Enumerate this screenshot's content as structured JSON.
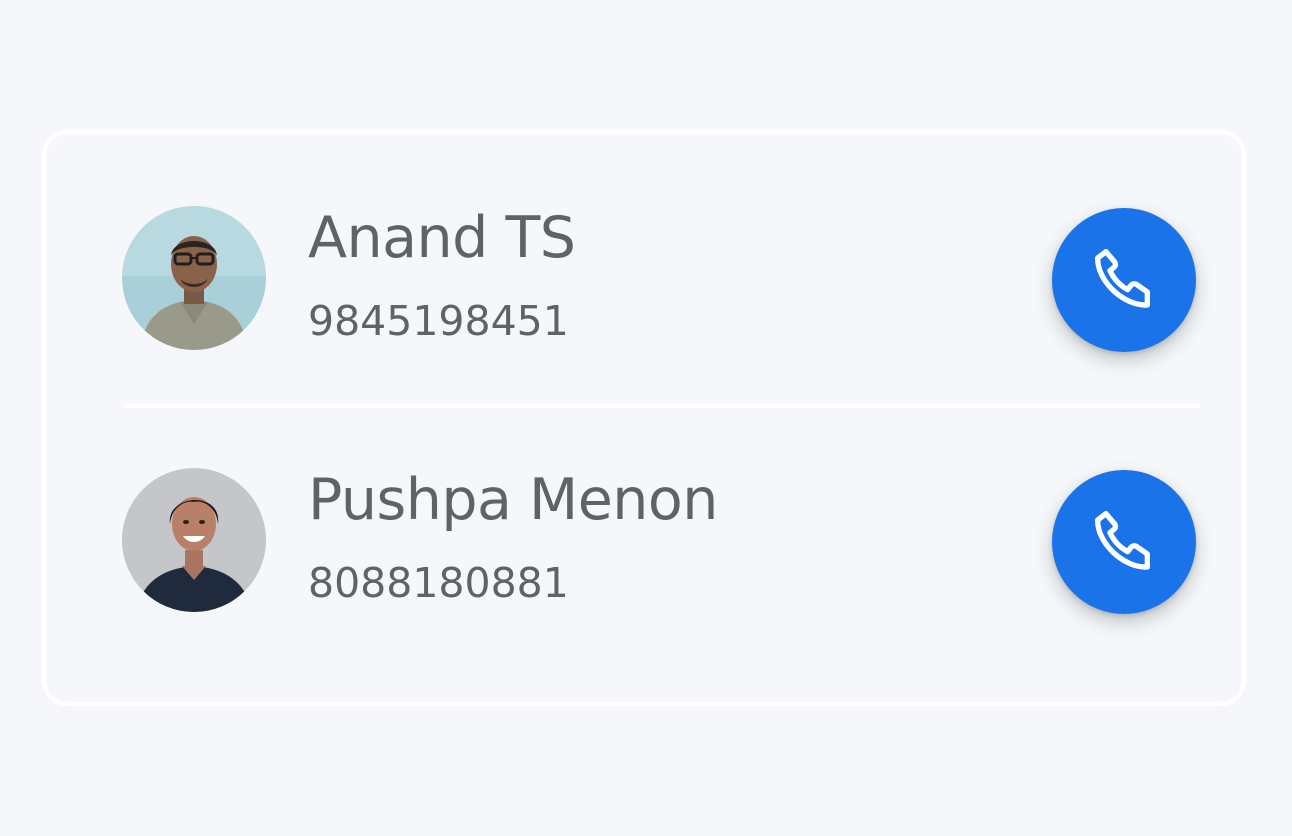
{
  "contacts": [
    {
      "name": "Anand TS",
      "phone": "9845198451",
      "avatar_icon": "person-photo-icon"
    },
    {
      "name": "Pushpa Menon",
      "phone": "8088180881",
      "avatar_icon": "person-photo-icon"
    }
  ],
  "colors": {
    "accent": "#1a73e8",
    "text": "#5f6368",
    "background": "#f5f7fa"
  },
  "call_icon": "phone-icon"
}
